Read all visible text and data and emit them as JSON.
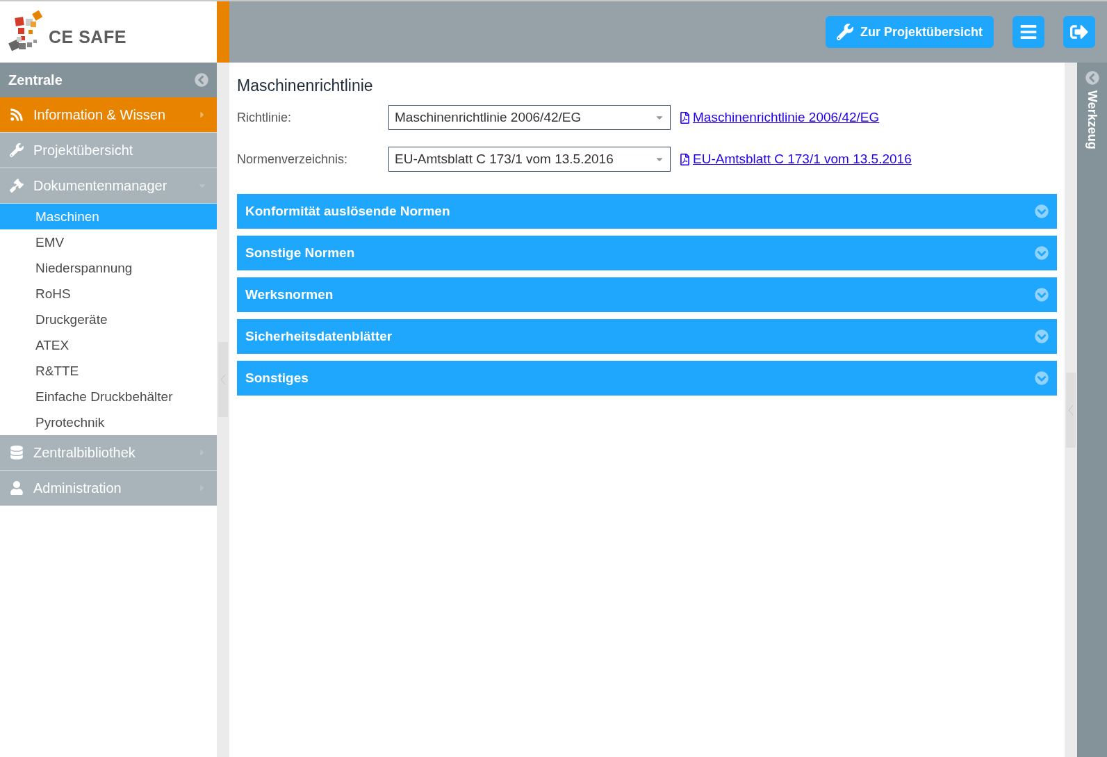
{
  "logo": {
    "text": "CE SAFE"
  },
  "toolbar": {
    "buttons": [
      {
        "kind": "project",
        "label": "Zur Projektübersicht"
      },
      {
        "kind": "menu"
      },
      {
        "kind": "logout"
      }
    ]
  },
  "sidebar": {
    "title": "Zentrale",
    "items": [
      {
        "kind": "menu",
        "label": "Information & Wissen",
        "selected": true,
        "expanded": false
      },
      {
        "kind": "link",
        "label": "Projektübersicht",
        "selected": false
      },
      {
        "kind": "menu",
        "label": "Dokumentenmanager",
        "selected": false,
        "expanded": true,
        "children": [
          {
            "label": "Maschinen",
            "selected": true
          },
          {
            "label": "EMV",
            "selected": false
          },
          {
            "label": "Niederspannung",
            "selected": false
          },
          {
            "label": "RoHS",
            "selected": false
          },
          {
            "label": "Druckgeräte",
            "selected": false
          },
          {
            "label": "ATEX",
            "selected": false
          },
          {
            "label": "R&TTE",
            "selected": false
          },
          {
            "label": "Einfache Druckbehälter",
            "selected": false
          },
          {
            "label": "Pyrotechnik",
            "selected": false
          }
        ]
      },
      {
        "kind": "menu",
        "label": "Zentralbibliothek",
        "selected": false,
        "expanded": false
      },
      {
        "kind": "menu",
        "label": "Administration",
        "selected": false,
        "expanded": false
      }
    ]
  },
  "main": {
    "title": "Maschinenrichtlinie",
    "fields": [
      {
        "label": "Richtlinie:",
        "value": "Maschinenrichtlinie 2006/42/EG",
        "link": "Maschinenrichtlinie 2006/42/EG"
      },
      {
        "label": "Normenverzeichnis:",
        "value": "EU-Amtsblatt C 173/1 vom 13.5.2016",
        "link": "EU-Amtsblatt C 173/1 vom 13.5.2016"
      }
    ],
    "sections": [
      {
        "title": "Konformität auslösende Normen",
        "expanded": false
      },
      {
        "title": "Sonstige Normen",
        "expanded": false
      },
      {
        "title": "Werksnormen",
        "expanded": false
      },
      {
        "title": "Sicherheitsdatenblätter",
        "expanded": false
      },
      {
        "title": "Sonstiges",
        "expanded": false
      }
    ]
  },
  "right_panel": {
    "title": "Werkzeug"
  }
}
